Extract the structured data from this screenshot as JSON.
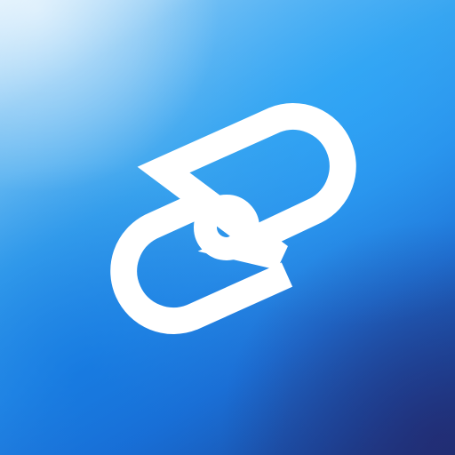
{
  "icon": {
    "name": "chain-link-icon",
    "foreground": "#ffffff",
    "background": [
      "#cfe9fb",
      "#3aa4ee",
      "#1e6fd4",
      "#1c347a"
    ]
  }
}
